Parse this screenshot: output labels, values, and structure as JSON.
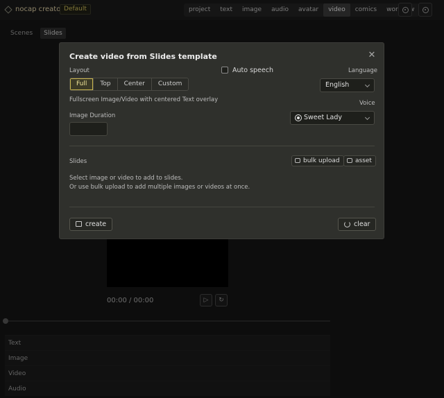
{
  "app": {
    "name": "nocap creator",
    "badge": "Default"
  },
  "nav": [
    "project",
    "text",
    "image",
    "audio",
    "avatar",
    "video",
    "comics",
    "workflow"
  ],
  "nav_active": "video",
  "subtabs": [
    "Scenes",
    "Slides"
  ],
  "subtab_active": "Slides",
  "player": {
    "timecode": "00:00 / 00:00"
  },
  "tracks": [
    "Text",
    "Image",
    "Video",
    "Audio"
  ],
  "modal": {
    "title": "Create video from Slides template",
    "layout_label": "Layout",
    "layout_options": [
      "Full",
      "Top",
      "Center",
      "Custom"
    ],
    "layout_selected": "Full",
    "layout_description": "Fullscreen Image/Video with centered Text overlay",
    "duration_label": "Image Duration",
    "duration_value": "",
    "auto_speech_label": "Auto speech",
    "auto_speech_checked": false,
    "language_label": "Language",
    "language_value": "English",
    "voice_label": "Voice",
    "voice_value": "Sweet Lady",
    "slides_label": "Slides",
    "bulk_upload_label": "bulk upload",
    "asset_label": "asset",
    "hint_line1": "Select image or video to add to slides.",
    "hint_line2": "Or use bulk upload to add multiple images or videos at once.",
    "create_label": "create",
    "clear_label": "clear"
  },
  "colors": {
    "accent": "#c9b64e",
    "background": "#141414",
    "modal": "#2f302c"
  },
  "icons": [
    "logo-icon",
    "gear-icon",
    "settings-icon",
    "close-icon",
    "play-icon",
    "replay-icon",
    "upload-icon",
    "folder-icon",
    "create-icon",
    "clear-icon",
    "chevron-down-icon"
  ]
}
